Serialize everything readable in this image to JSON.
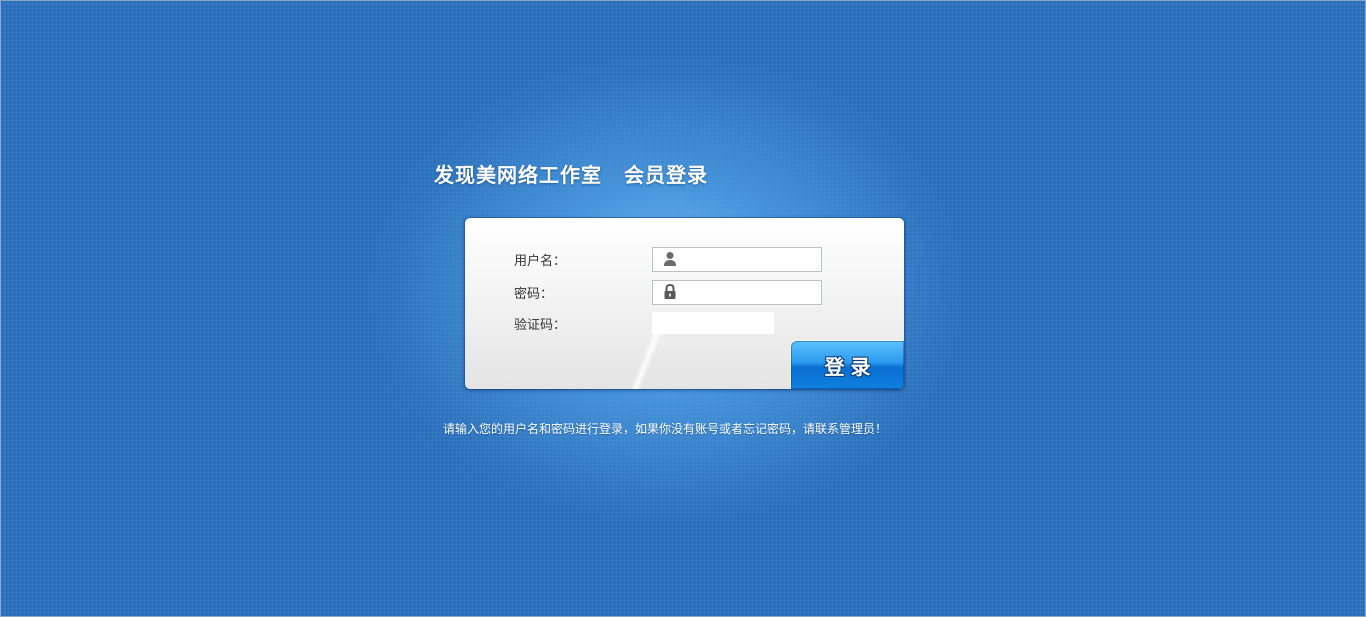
{
  "header": {
    "studio_name": "发现美网络工作室",
    "title": "会员登录"
  },
  "login_form": {
    "username": {
      "label": "用户名：",
      "value": "",
      "icon": "user-icon"
    },
    "password": {
      "label": "密码：",
      "value": "",
      "icon": "lock-icon"
    },
    "captcha": {
      "label": "验证码：",
      "value": ""
    },
    "submit_label": "登录"
  },
  "footer": {
    "hint": "请输入您的用户名和密码进行登录，如果你没有账号或者忘记密码，请联系管理员！"
  },
  "colors": {
    "background": "#2a6fba",
    "glow": "#78c3ff",
    "button": "#1a88e6",
    "text_on_blue": "#ffffff"
  }
}
